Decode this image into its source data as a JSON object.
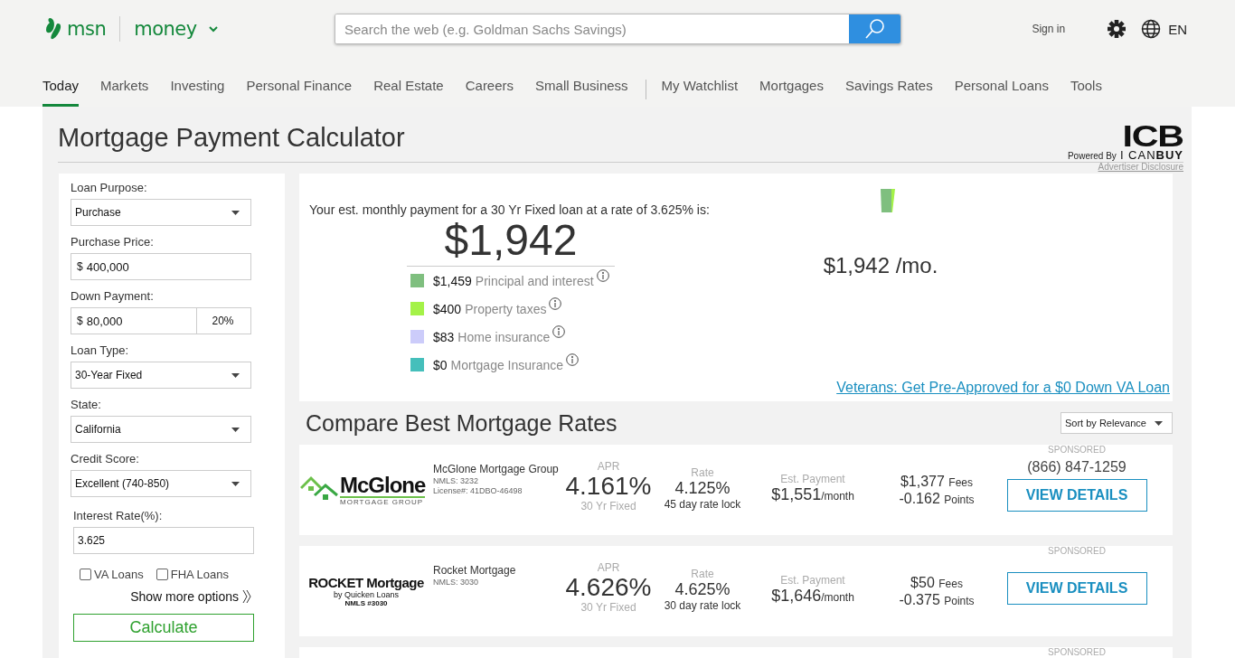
{
  "header": {
    "brand": "msn",
    "section": "money",
    "search": {
      "placeholder": "Search the web (e.g. Goldman Sachs Savings)"
    },
    "sign_in": "Sign in",
    "language": "EN"
  },
  "nav_primary": [
    {
      "label": "Today",
      "selected": true
    },
    {
      "label": "Markets",
      "selected": false
    },
    {
      "label": "Investing",
      "selected": false
    },
    {
      "label": "Personal Finance",
      "selected": false
    },
    {
      "label": "Real Estate",
      "selected": false
    },
    {
      "label": "Careers",
      "selected": false
    },
    {
      "label": "Small Business",
      "selected": false
    }
  ],
  "nav_secondary": [
    {
      "label": "My Watchlist",
      "selected": false
    },
    {
      "label": "Mortgages",
      "selected": false
    },
    {
      "label": "Savings Rates",
      "selected": false
    },
    {
      "label": "Personal Loans",
      "selected": false
    },
    {
      "label": "Tools",
      "selected": false
    }
  ],
  "page_title": "Mortgage Payment Calculator",
  "sponsor": {
    "mark": "ICB",
    "prefix": "Powered By",
    "name_light": "I CAN",
    "name_bold": "BUY",
    "disclosure": "Advertiser Disclosure"
  },
  "form": {
    "fields": [
      {
        "kind": "select",
        "label": "Loan Purpose:",
        "value": "Purchase"
      },
      {
        "kind": "money",
        "label": "Purchase Price:",
        "prefix": "$",
        "value": "400,000"
      },
      {
        "kind": "split",
        "label": "Down Payment:",
        "prefix": "$",
        "value": "80,000",
        "percent": "20%"
      },
      {
        "kind": "select",
        "label": "Loan Type:",
        "value": "30-Year Fixed"
      },
      {
        "kind": "select",
        "label": "State:",
        "value": "California"
      },
      {
        "kind": "select",
        "label": "Credit Score:",
        "value": "Excellent (740-850)"
      },
      {
        "kind": "text",
        "label": "Interest Rate(%):",
        "value": "3.625"
      }
    ],
    "checkboxes": [
      {
        "label": "VA Loans",
        "checked": false
      },
      {
        "label": "FHA Loans",
        "checked": false
      }
    ],
    "show_more": "Show more options",
    "submit": "Calculate"
  },
  "summary": {
    "intro": "Your est. monthly payment for a 30 Yr Fixed loan at a rate of 3.625% is:",
    "total": "$1,942",
    "breakdown": [
      {
        "amount": "$1,459",
        "label": "Principal and interest",
        "color": "#7fbf7f"
      },
      {
        "amount": "$400",
        "label": "Property taxes",
        "color": "#a4f248"
      },
      {
        "amount": "$83",
        "label": "Home insurance",
        "color": "#ccccfa"
      },
      {
        "amount": "$0",
        "label": "Mortgage Insurance",
        "color": "#45bfbb"
      }
    ],
    "chart_total": "$1,942 /mo.",
    "va_link": "Veterans: Get Pre-Approved for a $0 Down VA Loan"
  },
  "compare": {
    "title": "Compare Best Mortgage Rates",
    "sort": "Sort by Relevance",
    "offers": [
      {
        "logo": {
          "kind": "mcglone",
          "lines": [
            "McGlone",
            "MORTGAGE GROUP"
          ]
        },
        "name": "McGlone Mortgage Group",
        "details": [
          "NMLS: 3232",
          "License#: 41DBO-46498"
        ],
        "apr_label": "APR",
        "apr": "4.161%",
        "term": "30 Yr Fixed",
        "rate_label": "Rate",
        "rate": "4.125%",
        "lock": "45 day rate lock",
        "payment_label": "Est. Payment",
        "payment": "$1,551",
        "per": "/month",
        "fees": "$1,377",
        "fees_label": "Fees",
        "points": "-0.162",
        "points_label": "Points",
        "sponsored": "SPONSORED",
        "phone": "(866) 847-1259",
        "button": "VIEW DETAILS"
      },
      {
        "logo": {
          "kind": "rocket",
          "lines": [
            "ROCKET Mortgage",
            "by Quicken Loans",
            "NMLS #3030"
          ]
        },
        "name": "Rocket Mortgage",
        "details": [
          "NMLS: 3030"
        ],
        "apr_label": "APR",
        "apr": "4.626%",
        "term": "30 Yr Fixed",
        "rate_label": "Rate",
        "rate": "4.625%",
        "lock": "30 day rate lock",
        "payment_label": "Est. Payment",
        "payment": "$1,646",
        "per": "/month",
        "fees": "$50",
        "fees_label": "Fees",
        "points": "-0.375",
        "points_label": "Points",
        "sponsored": "SPONSORED",
        "button": "VIEW DETAILS"
      },
      {
        "sponsored": "SPONSORED"
      }
    ]
  }
}
